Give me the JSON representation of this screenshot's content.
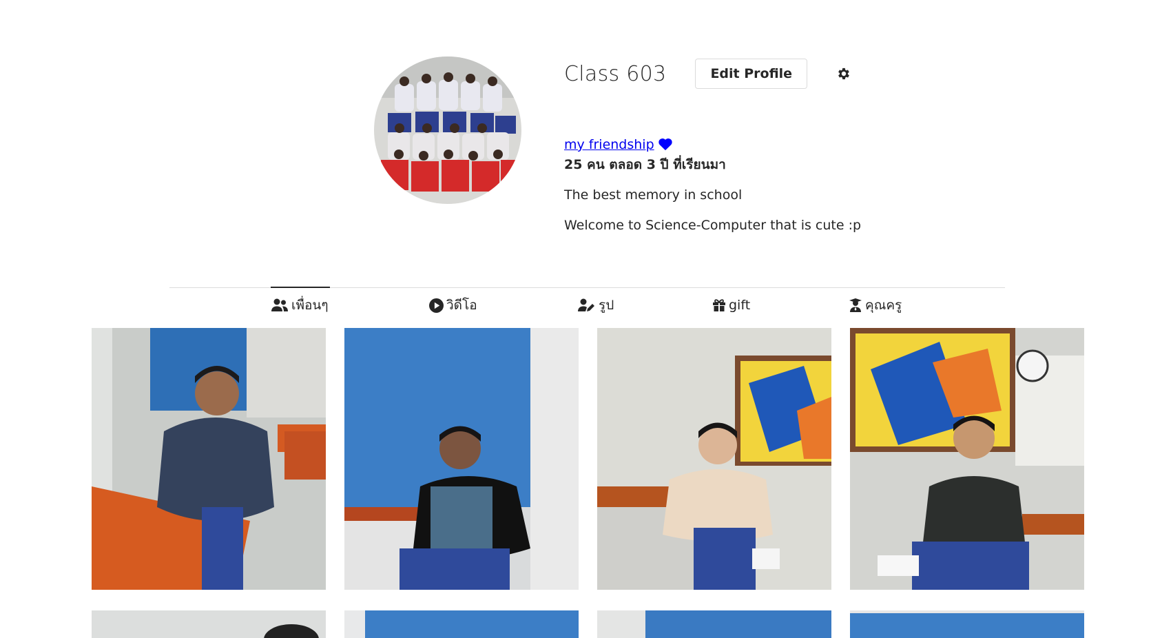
{
  "profile": {
    "username": "Class 603",
    "edit_button": "Edit Profile",
    "settings_icon": "gear-icon",
    "link_text": "my friendship",
    "link_icon": "heart-icon",
    "headline": "25 คน ตลอด 3 ปี ที่เรียนมา",
    "bio_lines": [
      "The best memory in school",
      "Welcome to Science-Computer that is cute :p"
    ]
  },
  "tabs": [
    {
      "label": "เพื่อนๆ",
      "icon": "users-icon",
      "active": true
    },
    {
      "label": "วิดีโอ",
      "icon": "play-circle-icon",
      "active": false
    },
    {
      "label": "รูป",
      "icon": "user-edit-icon",
      "active": false
    },
    {
      "label": "gift",
      "icon": "gift-icon",
      "active": false
    },
    {
      "label": "คุณครู",
      "icon": "teacher-icon",
      "active": false
    }
  ],
  "colors": {
    "link": "#0000ee",
    "heart": "#0000ff",
    "text": "#262626",
    "divider": "#dbdbdb"
  }
}
